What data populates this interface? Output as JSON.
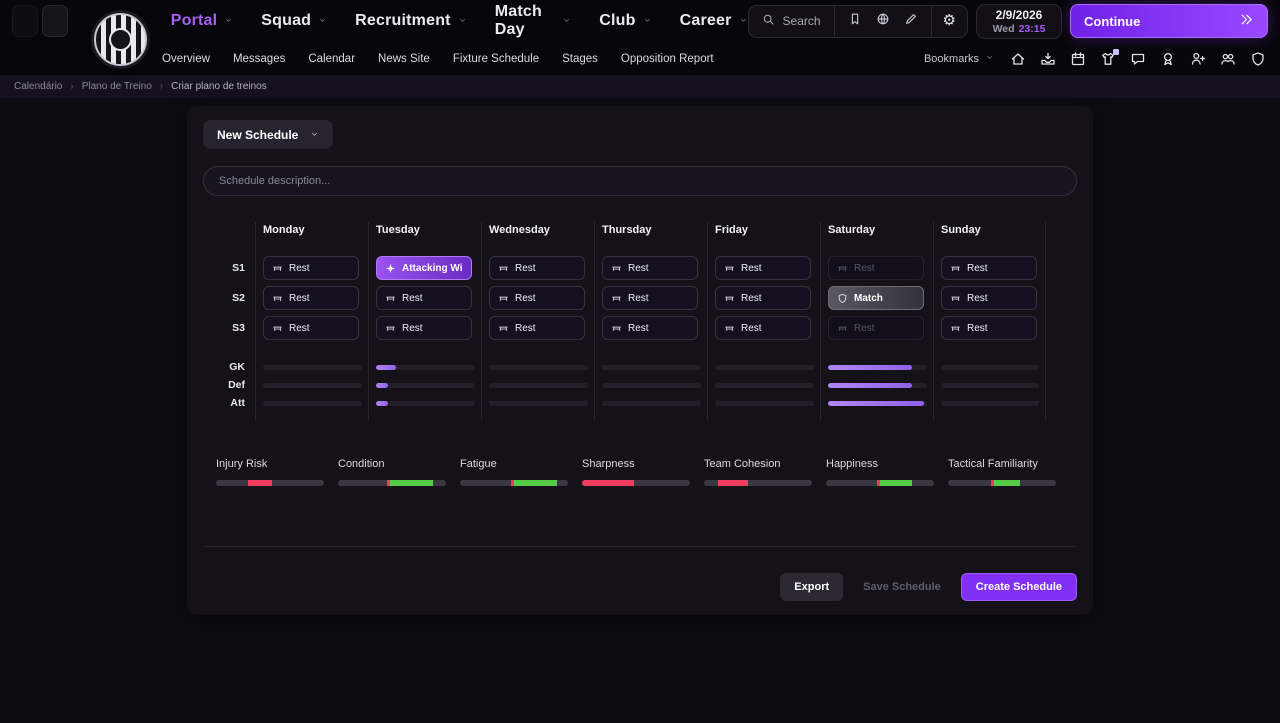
{
  "colors": {
    "accent": "#9b4df2",
    "negative": "#ef3e5c",
    "positive": "#55cc45",
    "training_fill": "#a678f0"
  },
  "top_nav": {
    "items": [
      {
        "label": "Portal",
        "active": true
      },
      {
        "label": "Squad",
        "active": false
      },
      {
        "label": "Recruitment",
        "active": false
      },
      {
        "label": "Match Day",
        "active": false
      },
      {
        "label": "Club",
        "active": false
      },
      {
        "label": "Career",
        "active": false
      }
    ],
    "search_label": "Search",
    "date": "2/9/2026",
    "day": "Wed",
    "time": "23:15",
    "continue_label": "Continue"
  },
  "sub_nav": {
    "items": [
      "Overview",
      "Messages",
      "Calendar",
      "News Site",
      "Fixture Schedule",
      "Stages",
      "Opposition Report"
    ],
    "bookmarks_label": "Bookmarks",
    "quick_icons": [
      {
        "name": "home-icon",
        "badge": false
      },
      {
        "name": "inbox-icon",
        "badge": false
      },
      {
        "name": "calendar-icon",
        "badge": false
      },
      {
        "name": "kit-icon",
        "badge": true
      },
      {
        "name": "chat-icon",
        "badge": false
      },
      {
        "name": "medal-icon",
        "badge": false
      },
      {
        "name": "player-add-icon",
        "badge": false
      },
      {
        "name": "squad-icon",
        "badge": false
      },
      {
        "name": "shield-icon",
        "badge": false
      }
    ]
  },
  "breadcrumb": {
    "items": [
      "Calendário",
      "Plano de Treino",
      "Criar plano de treinos"
    ]
  },
  "panel": {
    "schedule_name": "New Schedule",
    "description_placeholder": "Schedule description...",
    "session_labels": [
      "S1",
      "S2",
      "S3"
    ],
    "unit_labels": [
      "GK",
      "Def",
      "Att"
    ],
    "days": [
      {
        "label": "Monday",
        "sessions": [
          {
            "label": "Rest",
            "type": "rest"
          },
          {
            "label": "Rest",
            "type": "rest"
          },
          {
            "label": "Rest",
            "type": "rest"
          }
        ],
        "bars": [
          0,
          0,
          0
        ]
      },
      {
        "label": "Tuesday",
        "sessions": [
          {
            "label": "Attacking Wings",
            "type": "focus"
          },
          {
            "label": "Rest",
            "type": "rest"
          },
          {
            "label": "Rest",
            "type": "rest"
          }
        ],
        "bars": [
          20,
          12,
          12
        ]
      },
      {
        "label": "Wednesday",
        "sessions": [
          {
            "label": "Rest",
            "type": "rest"
          },
          {
            "label": "Rest",
            "type": "rest"
          },
          {
            "label": "Rest",
            "type": "rest"
          }
        ],
        "bars": [
          0,
          0,
          0
        ]
      },
      {
        "label": "Thursday",
        "sessions": [
          {
            "label": "Rest",
            "type": "rest"
          },
          {
            "label": "Rest",
            "type": "rest"
          },
          {
            "label": "Rest",
            "type": "rest"
          }
        ],
        "bars": [
          0,
          0,
          0
        ]
      },
      {
        "label": "Friday",
        "sessions": [
          {
            "label": "Rest",
            "type": "rest"
          },
          {
            "label": "Rest",
            "type": "rest"
          },
          {
            "label": "Rest",
            "type": "rest"
          }
        ],
        "bars": [
          0,
          0,
          0
        ]
      },
      {
        "label": "Saturday",
        "sessions": [
          {
            "label": "Rest",
            "type": "rest-off"
          },
          {
            "label": "Match",
            "type": "match"
          },
          {
            "label": "Rest",
            "type": "rest-off"
          }
        ],
        "bars": [
          85,
          85,
          97
        ]
      },
      {
        "label": "Sunday",
        "sessions": [
          {
            "label": "Rest",
            "type": "rest"
          },
          {
            "label": "Rest",
            "type": "rest"
          },
          {
            "label": "Rest",
            "type": "rest"
          }
        ],
        "bars": [
          0,
          0,
          0
        ]
      }
    ],
    "indicators": [
      {
        "label": "Injury Risk",
        "segments": [
          {
            "color": "negative",
            "start": 30,
            "end": 52
          }
        ]
      },
      {
        "label": "Condition",
        "segments": [
          {
            "color": "negative",
            "start": 45,
            "end": 48
          },
          {
            "color": "positive",
            "start": 48,
            "end": 88
          }
        ]
      },
      {
        "label": "Fatigue",
        "segments": [
          {
            "color": "negative",
            "start": 47,
            "end": 50
          },
          {
            "color": "positive",
            "start": 50,
            "end": 90
          }
        ]
      },
      {
        "label": "Sharpness",
        "segments": [
          {
            "color": "negative",
            "start": 0,
            "end": 48
          }
        ]
      },
      {
        "label": "Team Cohesion",
        "segments": [
          {
            "color": "negative",
            "start": 13,
            "end": 41
          }
        ]
      },
      {
        "label": "Happiness",
        "segments": [
          {
            "color": "negative",
            "start": 47,
            "end": 50
          },
          {
            "color": "positive",
            "start": 50,
            "end": 80
          }
        ]
      },
      {
        "label": "Tactical Familiarity",
        "segments": [
          {
            "color": "negative",
            "start": 40,
            "end": 43
          },
          {
            "color": "positive",
            "start": 43,
            "end": 67
          }
        ]
      }
    ],
    "footer": {
      "export": "Export",
      "save": "Save Schedule",
      "create": "Create Schedule"
    }
  }
}
